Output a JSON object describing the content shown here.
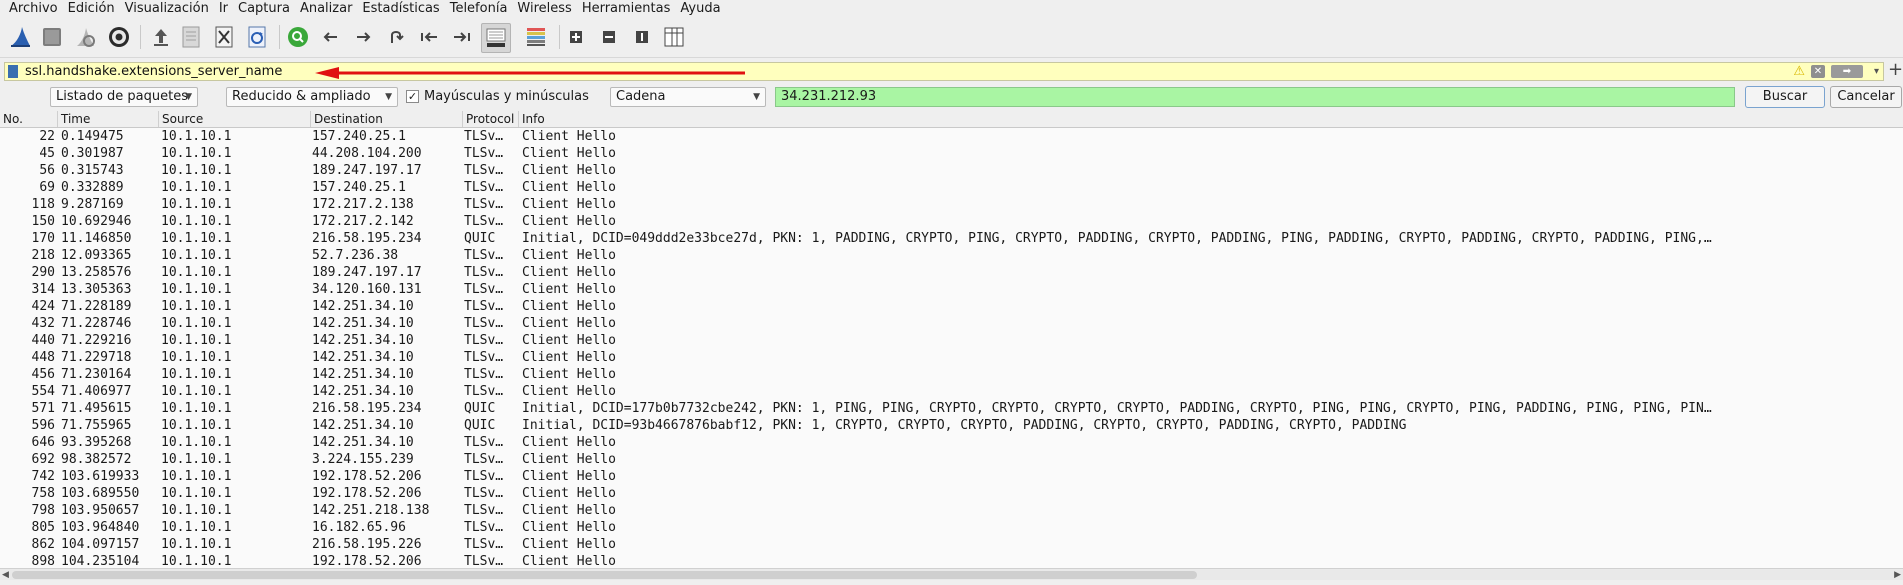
{
  "menu": [
    "Archivo",
    "Edición",
    "Visualización",
    "Ir",
    "Captura",
    "Analizar",
    "Estadísticas",
    "Telefonía",
    "Wireless",
    "Herramientas",
    "Ayuda"
  ],
  "toolbar": {
    "icons": [
      "shark-fin-icon",
      "stop-capture-icon",
      "restart-capture-icon",
      "capture-options-icon",
      "open-file-icon",
      "save-file-icon",
      "close-file-icon",
      "reload-file-icon",
      "find-packet-icon",
      "go-back-icon",
      "go-forward-icon",
      "go-to-packet-icon",
      "first-packet-icon",
      "last-packet-icon",
      "autoscroll-icon",
      "colorize-icon",
      "zoom-in-icon",
      "zoom-out-icon",
      "normal-size-icon",
      "resize-columns-icon"
    ]
  },
  "filter": {
    "text": "ssl.handshake.extensions_server_name",
    "warning_icon": "warning-icon",
    "add_label": "+"
  },
  "search": {
    "scope": "Listado de paquetes",
    "char_width": "Reducido & ampliado",
    "case_sensitive": true,
    "case_label": "Mayúsculas y minúsculas",
    "type": "Cadena",
    "value": "34.231.212.93",
    "find_label": "Buscar",
    "cancel_label": "Cancelar"
  },
  "columns": [
    "No.",
    "Time",
    "Source",
    "Destination",
    "Protocol",
    "Info"
  ],
  "packets": [
    {
      "no": "22",
      "time": "0.149475",
      "src": "10.1.10.1",
      "dst": "157.240.25.1",
      "proto": "TLSv…",
      "info": "Client Hello"
    },
    {
      "no": "45",
      "time": "0.301987",
      "src": "10.1.10.1",
      "dst": "44.208.104.200",
      "proto": "TLSv…",
      "info": "Client Hello"
    },
    {
      "no": "56",
      "time": "0.315743",
      "src": "10.1.10.1",
      "dst": "189.247.197.17",
      "proto": "TLSv…",
      "info": "Client Hello"
    },
    {
      "no": "69",
      "time": "0.332889",
      "src": "10.1.10.1",
      "dst": "157.240.25.1",
      "proto": "TLSv…",
      "info": "Client Hello"
    },
    {
      "no": "118",
      "time": "9.287169",
      "src": "10.1.10.1",
      "dst": "172.217.2.138",
      "proto": "TLSv…",
      "info": "Client Hello"
    },
    {
      "no": "150",
      "time": "10.692946",
      "src": "10.1.10.1",
      "dst": "172.217.2.142",
      "proto": "TLSv…",
      "info": "Client Hello"
    },
    {
      "no": "170",
      "time": "11.146850",
      "src": "10.1.10.1",
      "dst": "216.58.195.234",
      "proto": "QUIC",
      "info": "Initial, DCID=049ddd2e33bce27d, PKN: 1, PADDING, CRYPTO, PING, CRYPTO, PADDING, CRYPTO, PADDING, PING, PADDING, CRYPTO, PADDING, CRYPTO, PADDING, PING,…"
    },
    {
      "no": "218",
      "time": "12.093365",
      "src": "10.1.10.1",
      "dst": "52.7.236.38",
      "proto": "TLSv…",
      "info": "Client Hello"
    },
    {
      "no": "290",
      "time": "13.258576",
      "src": "10.1.10.1",
      "dst": "189.247.197.17",
      "proto": "TLSv…",
      "info": "Client Hello"
    },
    {
      "no": "314",
      "time": "13.305363",
      "src": "10.1.10.1",
      "dst": "34.120.160.131",
      "proto": "TLSv…",
      "info": "Client Hello"
    },
    {
      "no": "424",
      "time": "71.228189",
      "src": "10.1.10.1",
      "dst": "142.251.34.10",
      "proto": "TLSv…",
      "info": "Client Hello"
    },
    {
      "no": "432",
      "time": "71.228746",
      "src": "10.1.10.1",
      "dst": "142.251.34.10",
      "proto": "TLSv…",
      "info": "Client Hello"
    },
    {
      "no": "440",
      "time": "71.229216",
      "src": "10.1.10.1",
      "dst": "142.251.34.10",
      "proto": "TLSv…",
      "info": "Client Hello"
    },
    {
      "no": "448",
      "time": "71.229718",
      "src": "10.1.10.1",
      "dst": "142.251.34.10",
      "proto": "TLSv…",
      "info": "Client Hello"
    },
    {
      "no": "456",
      "time": "71.230164",
      "src": "10.1.10.1",
      "dst": "142.251.34.10",
      "proto": "TLSv…",
      "info": "Client Hello"
    },
    {
      "no": "554",
      "time": "71.406977",
      "src": "10.1.10.1",
      "dst": "142.251.34.10",
      "proto": "TLSv…",
      "info": "Client Hello"
    },
    {
      "no": "571",
      "time": "71.495615",
      "src": "10.1.10.1",
      "dst": "216.58.195.234",
      "proto": "QUIC",
      "info": "Initial, DCID=177b0b7732cbe242, PKN: 1, PING, PING, CRYPTO, CRYPTO, CRYPTO, CRYPTO, PADDING, CRYPTO, PING, PING, CRYPTO, PING, PADDING, PING, PING, PIN…"
    },
    {
      "no": "596",
      "time": "71.755965",
      "src": "10.1.10.1",
      "dst": "142.251.34.10",
      "proto": "QUIC",
      "info": "Initial, DCID=93b4667876babf12, PKN: 1, CRYPTO, CRYPTO, CRYPTO, PADDING, CRYPTO, CRYPTO, PADDING, CRYPTO, PADDING"
    },
    {
      "no": "646",
      "time": "93.395268",
      "src": "10.1.10.1",
      "dst": "142.251.34.10",
      "proto": "TLSv…",
      "info": "Client Hello"
    },
    {
      "no": "692",
      "time": "98.382572",
      "src": "10.1.10.1",
      "dst": "3.224.155.239",
      "proto": "TLSv…",
      "info": "Client Hello"
    },
    {
      "no": "742",
      "time": "103.619933",
      "src": "10.1.10.1",
      "dst": "192.178.52.206",
      "proto": "TLSv…",
      "info": "Client Hello"
    },
    {
      "no": "758",
      "time": "103.689550",
      "src": "10.1.10.1",
      "dst": "192.178.52.206",
      "proto": "TLSv…",
      "info": "Client Hello"
    },
    {
      "no": "798",
      "time": "103.950657",
      "src": "10.1.10.1",
      "dst": "142.251.218.138",
      "proto": "TLSv…",
      "info": "Client Hello"
    },
    {
      "no": "805",
      "time": "103.964840",
      "src": "10.1.10.1",
      "dst": "16.182.65.96",
      "proto": "TLSv…",
      "info": "Client Hello"
    },
    {
      "no": "862",
      "time": "104.097157",
      "src": "10.1.10.1",
      "dst": "216.58.195.226",
      "proto": "TLSv…",
      "info": "Client Hello"
    },
    {
      "no": "898",
      "time": "104.235104",
      "src": "10.1.10.1",
      "dst": "192.178.52.206",
      "proto": "TLSv…",
      "info": "Client Hello"
    }
  ],
  "colors": {
    "filter_bg": "#ffffbe",
    "search_match_bg": "#a9f5a3",
    "annotation_arrow": "#e01010"
  }
}
